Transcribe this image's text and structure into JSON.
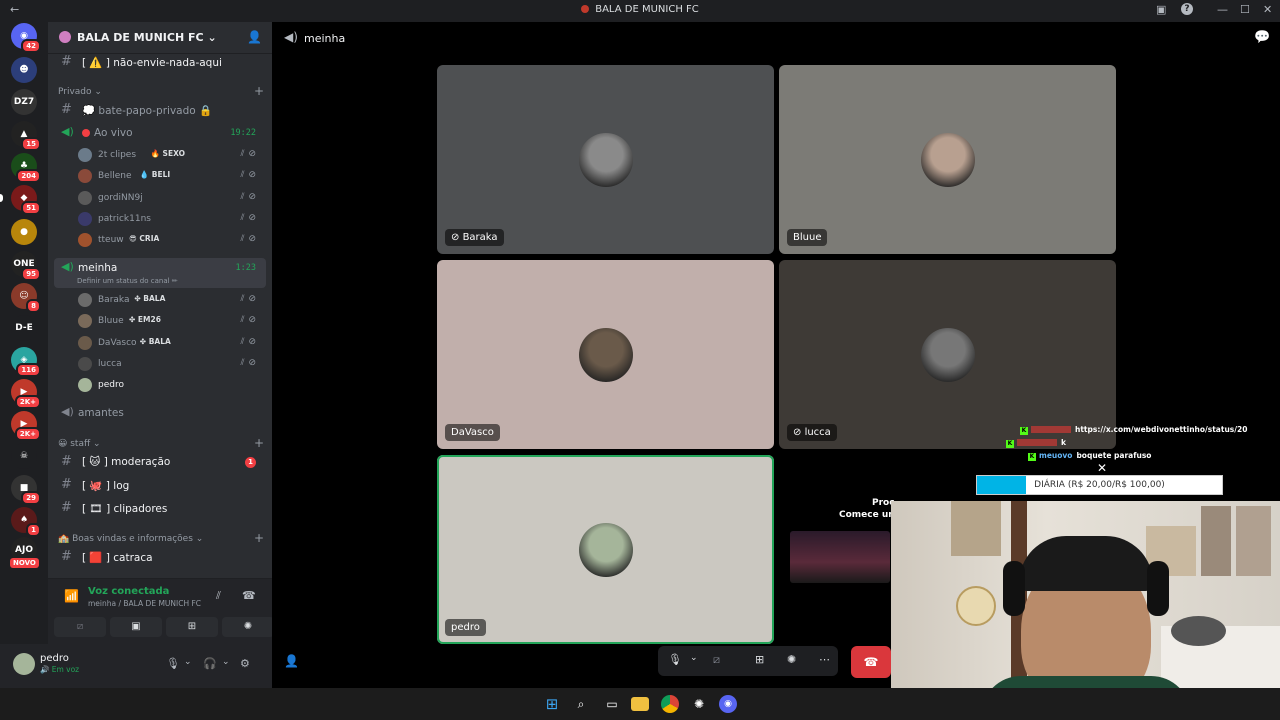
{
  "window": {
    "title": "BALA DE MUNICH FC",
    "back_icon": "←",
    "inbox_icon": "▣",
    "help_icon": "?",
    "minimize": "—",
    "maximize": "☐",
    "close": "✕"
  },
  "rail": {
    "servers": [
      {
        "badge": "42",
        "color": "#5865f2",
        "label": "◉"
      },
      {
        "badge": "",
        "color": "#2c3e7a",
        "label": "☻"
      },
      {
        "badge": "",
        "color": "#333",
        "label": "DZ7"
      },
      {
        "badge": "15",
        "color": "#222",
        "label": "▲"
      },
      {
        "badge": "204",
        "color": "#1a4d1a",
        "label": "♣"
      },
      {
        "badge": "51",
        "color": "#7a1a1a",
        "label": "◆"
      },
      {
        "badge": "",
        "color": "#b8860b",
        "label": "●"
      },
      {
        "badge": "95",
        "color": "#222",
        "label": "ONE"
      },
      {
        "badge": "8",
        "color": "#8a3a2a",
        "label": "☺"
      },
      {
        "badge": "",
        "color": "#1e1f22",
        "label": "D-E"
      },
      {
        "badge": "116",
        "color": "#2aa5a0",
        "label": "◈"
      },
      {
        "badge": "2K+",
        "color": "#c0392b",
        "label": "▶"
      },
      {
        "badge": "2K+",
        "color": "#c0392b",
        "label": "▶"
      },
      {
        "badge": "",
        "color": "#1e1f22",
        "label": "☠"
      },
      {
        "badge": "29",
        "color": "#333",
        "label": "■"
      },
      {
        "badge": "1",
        "color": "#5a1a1a",
        "label": "♠"
      },
      {
        "badge": "",
        "color": "#222",
        "label": "AJO"
      }
    ],
    "new_label": "NOVO"
  },
  "server": {
    "name": "BALA DE MUNICH FC",
    "chevron": "⌄",
    "invite_icon": "👤"
  },
  "channels": {
    "top_channel": "[ ⚠️ ] não-envie-nada-aqui",
    "cat_privado": "Privado ⌄",
    "bate_papo": "💭 bate-papo-privado 🔒",
    "ao_vivo": {
      "name": "Ao vivo",
      "time": "19:22",
      "users": [
        {
          "name": "2t clipes",
          "tag": "🔥 SEXO",
          "color": "#6b7b8a"
        },
        {
          "name": "Bellene",
          "tag": "💧 BELI",
          "color": "#8a4a3a"
        },
        {
          "name": "gordiNN9j",
          "tag": "",
          "color": "#5a5a5a"
        },
        {
          "name": "patrick11ns",
          "tag": "",
          "color": "#3a3a6a"
        },
        {
          "name": "tteuw",
          "tag": "😎 CRIA",
          "color": "#a0522d"
        }
      ]
    },
    "meinha": {
      "name": "meinha",
      "time": "1:23",
      "status_hint": "Definir um status do canal ✏",
      "users": [
        {
          "name": "Baraka",
          "tag": "✤ BALA",
          "color": "#6b6b6b"
        },
        {
          "name": "Bluue",
          "tag": "✤ EM26",
          "color": "#7a6a5a"
        },
        {
          "name": "DaVasco",
          "tag": "✤ BALA",
          "color": "#6a5a4a"
        },
        {
          "name": "lucca",
          "tag": "",
          "color": "#4a4a4a"
        },
        {
          "name": "pedro",
          "tag": "",
          "color": "#a5b59a"
        }
      ]
    },
    "amantes": "amantes",
    "cat_staff": "😀 staff ⌄",
    "moderacao": "[ 🐱 ] moderação",
    "moderacao_badge": "1",
    "log": "[ 🐙 ] log",
    "clipadores": "[ 🎞 ] clipadores",
    "cat_boas": "🏫 Boas vindas e informações ⌄",
    "catraca": "[ 🟥 ] catraca"
  },
  "voice": {
    "status": "Voz conectada",
    "location": "meinha / BALA DE MUNICH FC"
  },
  "user": {
    "name": "pedro",
    "status": "🔊 Em voz"
  },
  "main": {
    "channel_name": "meinha",
    "tiles": [
      {
        "name": "Baraka",
        "bg": "#4e5052",
        "avatar": "#8a8a8a",
        "muted": true
      },
      {
        "name": "Bluue",
        "bg": "#7c7b76",
        "avatar": "#b8a090",
        "muted": false
      },
      {
        "name": "DaVasco",
        "bg": "#c1afab",
        "avatar": "#6a5a4a",
        "muted": false
      },
      {
        "name": "lucca",
        "bg": "#3e3a36",
        "avatar": "#777",
        "muted": true
      },
      {
        "name": "pedro",
        "bg": "#cbc8c1",
        "avatar": "#a5b59a",
        "muted": false
      }
    ]
  },
  "controls": {
    "mic_icon": "🎙",
    "chevron": "⌄",
    "video_icon": "⧄",
    "activities_icon": "⊞",
    "soundboard_icon": "✺",
    "more_icon": "⋯",
    "hangup_icon": "☎"
  },
  "overlay": {
    "chat": [
      {
        "nick": "",
        "nick_color": "#e53935",
        "text": "https://x.com/webdivonettinho/status/20"
      },
      {
        "nick": "",
        "nick_color": "#e53935",
        "text": "k"
      },
      {
        "nick": "meuovo",
        "nick_color": "#64b5f6",
        "text": "boquete parafuso"
      }
    ],
    "goal_text": "DIÁRIA (R$ 20,00/R$ 100,00)",
    "goal_progress": 0.2,
    "promo_line1": "Proc",
    "promo_line2": "Comece um j"
  },
  "taskbar": {
    "icons": [
      "windows-icon",
      "search-icon",
      "task-view-icon",
      "explorer-icon",
      "chrome-icon",
      "app-icon",
      "discord-icon"
    ]
  }
}
